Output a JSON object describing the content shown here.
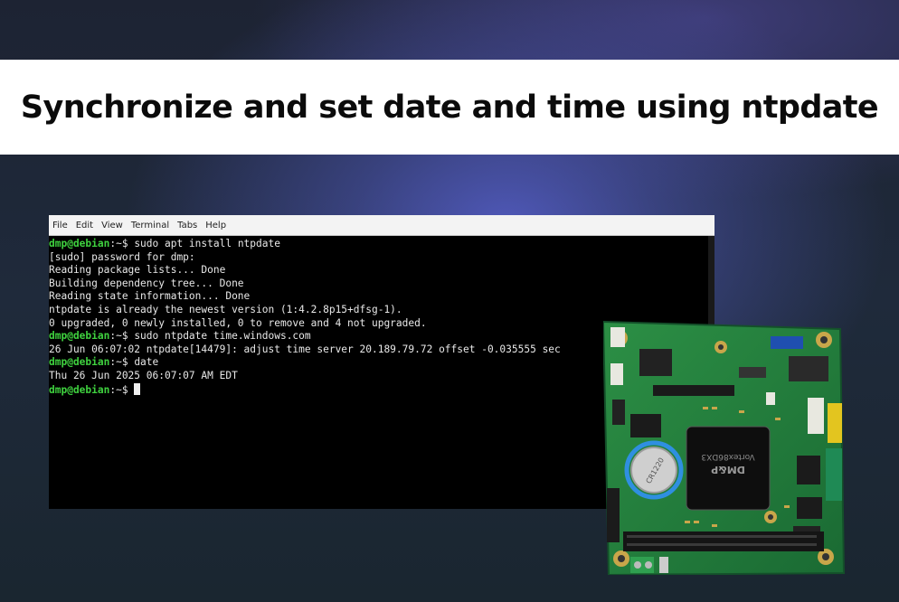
{
  "banner": {
    "title": "Synchronize and set date and time using ntpdate"
  },
  "terminal": {
    "menu": [
      "File",
      "Edit",
      "View",
      "Terminal",
      "Tabs",
      "Help"
    ],
    "lines": [
      {
        "prompt": "dmp@debian",
        "sep": ":~$ ",
        "text": "sudo apt install ntpdate"
      },
      {
        "text": "[sudo] password for dmp:"
      },
      {
        "text": "Reading package lists... Done"
      },
      {
        "text": "Building dependency tree... Done"
      },
      {
        "text": "Reading state information... Done"
      },
      {
        "text": "ntpdate is already the newest version (1:4.2.8p15+dfsg-1)."
      },
      {
        "text": "0 upgraded, 0 newly installed, 0 to remove and 4 not upgraded."
      },
      {
        "prompt": "dmp@debian",
        "sep": ":~$ ",
        "text": "sudo ntpdate time.windows.com"
      },
      {
        "text": "26 Jun 06:07:02 ntpdate[14479]: adjust time server 20.189.79.72 offset -0.035555 sec"
      },
      {
        "prompt": "dmp@debian",
        "sep": ":~$ ",
        "text": "date"
      },
      {
        "text": "Thu 26 Jun 2025 06:07:07 AM EDT"
      },
      {
        "prompt": "dmp@debian",
        "sep": ":~$ ",
        "text": "",
        "cursor": true
      }
    ]
  },
  "board": {
    "chip_labels": [
      "DM&P",
      "Vortex86DX3"
    ],
    "battery_label": "CR1220"
  },
  "colors": {
    "prompt": "#3fd23f",
    "accent_ring": "#2f8fe0",
    "pcb": "#1f7a3a"
  }
}
